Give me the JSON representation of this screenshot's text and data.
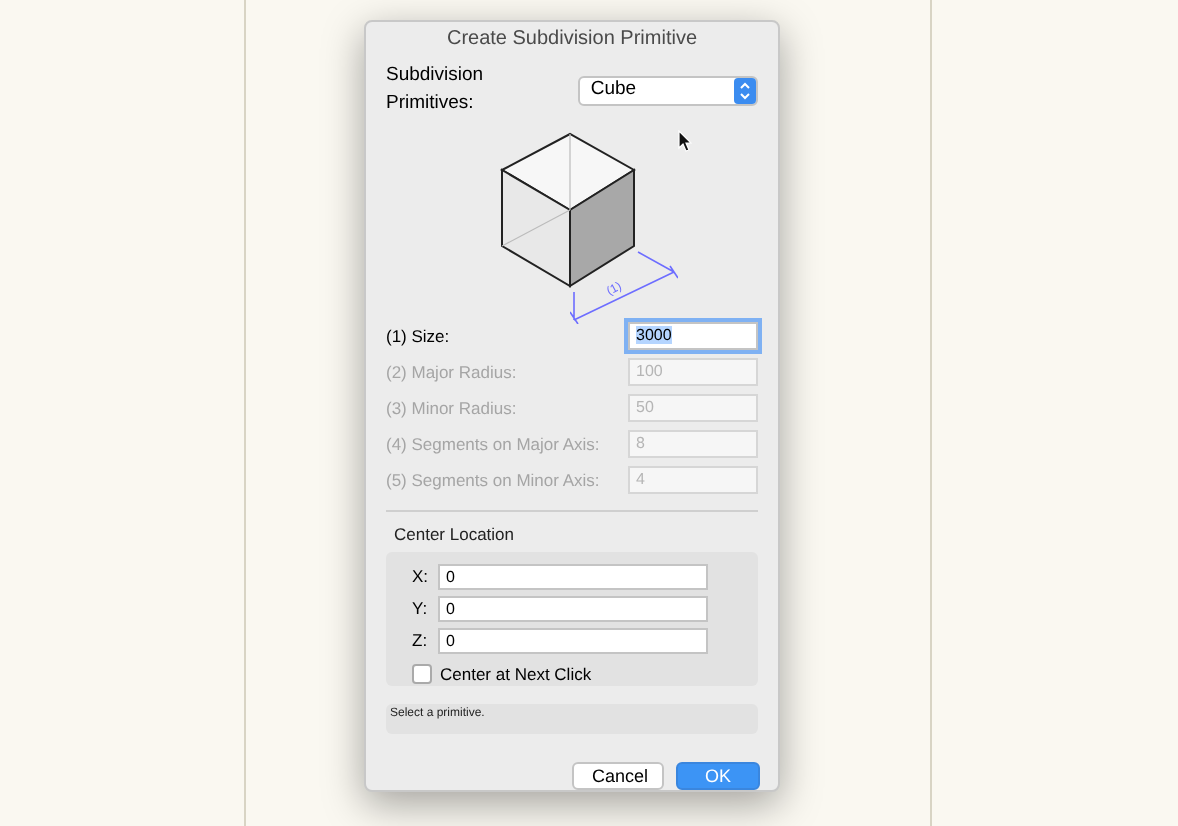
{
  "window": {
    "title": "Create Subdivision Primitive"
  },
  "primitive": {
    "label": "Subdivision Primitives:",
    "value": "Cube"
  },
  "diagram": {
    "dimension_label": "(1)"
  },
  "parameters": [
    {
      "label": "(1) Size:",
      "value": "3000",
      "disabled": false,
      "selected": true
    },
    {
      "label": "(2) Major Radius:",
      "value": "100",
      "disabled": true,
      "selected": false
    },
    {
      "label": "(3) Minor Radius:",
      "value": "50",
      "disabled": true,
      "selected": false
    },
    {
      "label": "(4) Segments on Major Axis:",
      "value": "8",
      "disabled": true,
      "selected": false
    },
    {
      "label": "(5) Segments on Minor Axis:",
      "value": "4",
      "disabled": true,
      "selected": false
    }
  ],
  "center_location": {
    "title": "Center Location",
    "fields": [
      {
        "label": "X:",
        "value": "0"
      },
      {
        "label": "Y:",
        "value": "0"
      },
      {
        "label": "Z:",
        "value": "0"
      }
    ],
    "center_at_next_click": {
      "label": "Center at Next Click",
      "checked": false
    }
  },
  "status": "Select a primitive.",
  "buttons": [
    {
      "label": "Cancel",
      "kind": "secondary"
    },
    {
      "label": "OK",
      "kind": "default"
    }
  ]
}
